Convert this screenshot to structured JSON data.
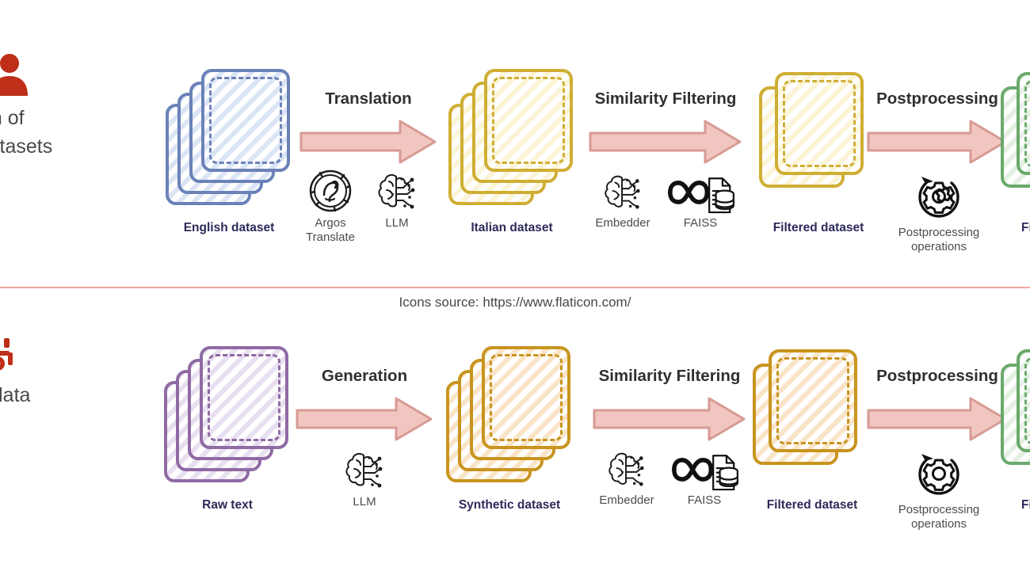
{
  "source_note": "Icons source: https://www.flaticon.com/",
  "colors": {
    "arrow_fill": "#f1c6c1",
    "arrow_stroke": "#d79a93",
    "divider": "#eda79c",
    "label_text": "#2d2a5a",
    "title_text": "#303030",
    "caption_icon_red": "#bf2e18",
    "blue_border": "#6b82b8",
    "blue_fill": "#dce5f5",
    "yellow_border": "#cfae34",
    "yellow_fill": "#fbf4d6",
    "gold_border": "#c8941e",
    "orange_fill": "#fae4c8",
    "purple_border": "#8f6aa4",
    "purple_fill": "#e8dff0",
    "green_border": "#6aa96b",
    "green_fill": "#e3f0e2"
  },
  "rows": [
    {
      "id": "translation-pipeline",
      "caption": {
        "icon": "user-translate-icon",
        "text": "Translation of\nexisting datasets"
      },
      "stages": [
        {
          "kind": "dataset",
          "name": "english-dataset",
          "label": "English dataset",
          "sheets": 4,
          "palette": "blue"
        },
        {
          "kind": "transition",
          "name": "translation-step",
          "title": "Translation",
          "tools": [
            {
              "icon": "argos-translate-icon",
              "label": "Argos\nTranslate"
            },
            {
              "icon": "llm-brain-icon",
              "label": "LLM"
            }
          ]
        },
        {
          "kind": "dataset",
          "name": "italian-dataset",
          "label": "Italian dataset",
          "sheets": 4,
          "palette": "yellow"
        },
        {
          "kind": "transition",
          "name": "similarity-filtering-step",
          "title": "Similarity Filtering",
          "tools": [
            {
              "icon": "embedder-brain-icon",
              "label": "Embedder"
            },
            {
              "icon": "faiss-icon",
              "label": "FAISS"
            }
          ]
        },
        {
          "kind": "dataset",
          "name": "filtered-dataset",
          "label": "Filtered dataset",
          "sheets": 2,
          "palette": "yellow"
        },
        {
          "kind": "transition",
          "name": "postprocessing-step",
          "title": "Postprocessing",
          "tools": [
            {
              "icon": "gear-refresh-icon",
              "label": "Postprocessing\noperations"
            }
          ]
        },
        {
          "kind": "dataset",
          "name": "final-dataset",
          "label": "Fin",
          "sheets": 2,
          "palette": "green"
        }
      ]
    },
    {
      "id": "synthetic-pipeline",
      "caption": {
        "icon": "synthetic-data-icon",
        "text": "Synthetic data\ngeneration"
      },
      "stages": [
        {
          "kind": "dataset",
          "name": "raw-text",
          "label": "Raw text",
          "sheets": 4,
          "palette": "purple"
        },
        {
          "kind": "transition",
          "name": "generation-step",
          "title": "Generation",
          "tools": [
            {
              "icon": "llm-brain-icon",
              "label": "LLM"
            }
          ]
        },
        {
          "kind": "dataset",
          "name": "synthetic-dataset",
          "label": "Synthetic dataset",
          "sheets": 4,
          "palette": "orange"
        },
        {
          "kind": "transition",
          "name": "similarity-filtering-step",
          "title": "Similarity Filtering",
          "tools": [
            {
              "icon": "embedder-brain-icon",
              "label": "Embedder"
            },
            {
              "icon": "faiss-icon",
              "label": "FAISS"
            }
          ]
        },
        {
          "kind": "dataset",
          "name": "filtered-dataset",
          "label": "Filtered dataset",
          "sheets": 2,
          "palette": "orange"
        },
        {
          "kind": "transition",
          "name": "postprocessing-step",
          "title": "Postprocessing",
          "tools": [
            {
              "icon": "gear-refresh-icon",
              "label": "Postprocessing\noperations"
            }
          ]
        },
        {
          "kind": "dataset",
          "name": "final-dataset",
          "label": "Fin",
          "sheets": 2,
          "palette": "green"
        }
      ]
    }
  ]
}
